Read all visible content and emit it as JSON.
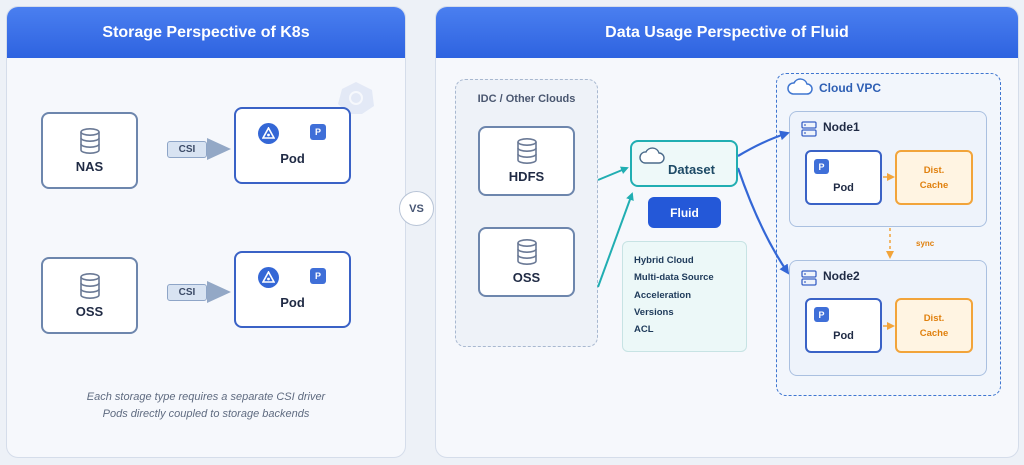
{
  "left_panel": {
    "title": "Storage Perspective of K8s",
    "storage": [
      {
        "label": "NAS",
        "icon": "database-icon"
      },
      {
        "label": "OSS",
        "icon": "database-icon"
      }
    ],
    "connector_label": "CSI",
    "pod_label": "Pod",
    "pod_badge": "P",
    "caption_lines": [
      "Each storage type requires a separate CSI driver",
      "Pods directly coupled to storage backends"
    ]
  },
  "vs_label": "VS",
  "right_panel": {
    "title": "Data Usage Perspective of Fluid",
    "idc": {
      "title": "IDC / Other Clouds",
      "items": [
        {
          "label": "HDFS",
          "icon": "database-icon"
        },
        {
          "label": "OSS",
          "icon": "database-icon"
        }
      ]
    },
    "dataset_label": "Dataset",
    "fluid_label": "Fluid",
    "features": [
      "Hybrid Cloud",
      "Multi-data Source",
      "Acceleration",
      "Versions",
      "ACL"
    ],
    "vpc": {
      "title": "Cloud VPC",
      "nodes": [
        {
          "name": "Node1",
          "pod_label": "Pod",
          "pod_badge": "P",
          "cache_line1": "Dist.",
          "cache_line2": "Cache"
        },
        {
          "name": "Node2",
          "pod_label": "Pod",
          "pod_badge": "P",
          "cache_line1": "Dist.",
          "cache_line2": "Cache"
        }
      ],
      "sync_label": "sync"
    }
  },
  "colors": {
    "header_blue": "#2e63e0",
    "teal": "#21aeb2",
    "cache_orange": "#f2a43a",
    "arrow_blue": "#3467d6"
  }
}
